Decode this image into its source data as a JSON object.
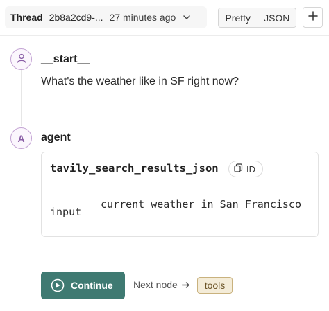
{
  "header": {
    "thread_label": "Thread",
    "thread_id": "2b8a2cd9-...",
    "thread_time": "27 minutes ago",
    "view_options": [
      "Pretty",
      "JSON"
    ],
    "add_icon": "plus-icon",
    "dropdown_icon": "chevron-down-icon"
  },
  "nodes": [
    {
      "title": "__start__",
      "icon": "user-icon",
      "message": "What's the weather like in SF right now?"
    },
    {
      "title": "agent",
      "avatar_letter": "A",
      "tool_call": {
        "name": "tavily_search_results_json",
        "id_label": "ID",
        "id_icon": "copy-icon",
        "args": [
          {
            "key": "input",
            "value": "current weather in San Francisco"
          }
        ]
      }
    }
  ],
  "footer": {
    "continue_label": "Continue",
    "continue_icon": "play-circle-icon",
    "next_node_label": "Next node",
    "arrow_icon": "arrow-right-icon",
    "next_node_value": "tools"
  },
  "colors": {
    "accent_button": "#3f7a72",
    "avatar_border": "#c4a4d4",
    "avatar_text": "#8a5fa6",
    "badge_bg": "#f4ecd8",
    "badge_border": "#c9b27e"
  }
}
